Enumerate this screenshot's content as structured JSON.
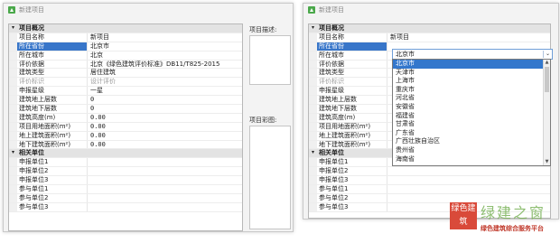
{
  "left": {
    "title": "新建项目",
    "rows": [
      {
        "type": "cat",
        "key": "项目概况",
        "expander": "▾"
      },
      {
        "type": "row",
        "key": "项目名称",
        "val": "新项目"
      },
      {
        "type": "row",
        "key": "所在省份",
        "val": "北京市",
        "sel": true
      },
      {
        "type": "row",
        "key": "所在城市",
        "val": "北京"
      },
      {
        "type": "row",
        "key": "评价依据",
        "val": "北京《绿色建筑评价标准》DB11/T825-2015"
      },
      {
        "type": "row",
        "key": "建筑类型",
        "val": "居住建筑"
      },
      {
        "type": "row",
        "key": "评价标识",
        "val": "设计评价",
        "dis": true
      },
      {
        "type": "row",
        "key": "申报星级",
        "val": "一星"
      },
      {
        "type": "row",
        "key": "建筑地上层数",
        "val": "0"
      },
      {
        "type": "row",
        "key": "建筑地下层数",
        "val": "0"
      },
      {
        "type": "row",
        "key": "建筑高度(m)",
        "val": "0.00"
      },
      {
        "type": "row",
        "key": "项目用地面积(m²)",
        "val": "0.00"
      },
      {
        "type": "row",
        "key": "地上建筑面积(m²)",
        "val": "0.00"
      },
      {
        "type": "row",
        "key": "地下建筑面积(m²)",
        "val": "0.00"
      },
      {
        "type": "cat",
        "key": "相关单位",
        "expander": "▾"
      },
      {
        "type": "row",
        "key": "申报单位1",
        "val": ""
      },
      {
        "type": "row",
        "key": "申报单位2",
        "val": ""
      },
      {
        "type": "row",
        "key": "申报单位3",
        "val": ""
      },
      {
        "type": "row",
        "key": "参与单位1",
        "val": ""
      },
      {
        "type": "row",
        "key": "参与单位2",
        "val": ""
      },
      {
        "type": "row",
        "key": "参与单位3",
        "val": ""
      }
    ],
    "description_label": "项目描述:",
    "image_label": "项目彩图:"
  },
  "right": {
    "title": "新建项目",
    "rows": [
      {
        "type": "cat",
        "key": "项目概况",
        "expander": "▾"
      },
      {
        "type": "row",
        "key": "项目名称",
        "val": "新项目"
      },
      {
        "type": "row",
        "key": "所在省份",
        "val": "",
        "sel": true
      },
      {
        "type": "row",
        "key": "所在城市",
        "val": ""
      },
      {
        "type": "row",
        "key": "评价依据",
        "val": ""
      },
      {
        "type": "row",
        "key": "建筑类型",
        "val": ""
      },
      {
        "type": "row",
        "key": "评价标识",
        "val": "",
        "dis": true
      },
      {
        "type": "row",
        "key": "申报星级",
        "val": ""
      },
      {
        "type": "row",
        "key": "建筑地上层数",
        "val": ""
      },
      {
        "type": "row",
        "key": "建筑地下层数",
        "val": ""
      },
      {
        "type": "row",
        "key": "建筑高度(m)",
        "val": ""
      },
      {
        "type": "row",
        "key": "项目用地面积(m²)",
        "val": ""
      },
      {
        "type": "row",
        "key": "地上建筑面积(m²)",
        "val": ""
      },
      {
        "type": "row",
        "key": "地下建筑面积(m²)",
        "val": ""
      },
      {
        "type": "cat",
        "key": "相关单位",
        "expander": "▾"
      },
      {
        "type": "row",
        "key": "申报单位1",
        "val": ""
      },
      {
        "type": "row",
        "key": "申报单位2",
        "val": ""
      },
      {
        "type": "row",
        "key": "申报单位3",
        "val": ""
      },
      {
        "type": "row",
        "key": "参与单位1",
        "val": ""
      },
      {
        "type": "row",
        "key": "参与单位2",
        "val": ""
      },
      {
        "type": "row",
        "key": "参与单位3",
        "val": ""
      }
    ],
    "dropdown": {
      "value": "北京市",
      "button": "⌄",
      "options": [
        "北京市",
        "天津市",
        "上海市",
        "重庆市",
        "河北省",
        "安徽省",
        "福建省",
        "甘肃省",
        "广东省",
        "广西壮族自治区",
        "贵州省",
        "海南省"
      ],
      "highlighted": 0
    }
  },
  "watermark": {
    "seal_text": "绿色建筑",
    "main_text": "绿建之窗",
    "sub_text": "绿色建筑综合服务平台"
  },
  "colors": {
    "selection": "#3876c9",
    "category": "#e3e3e3",
    "logo": "#4aa84a"
  }
}
